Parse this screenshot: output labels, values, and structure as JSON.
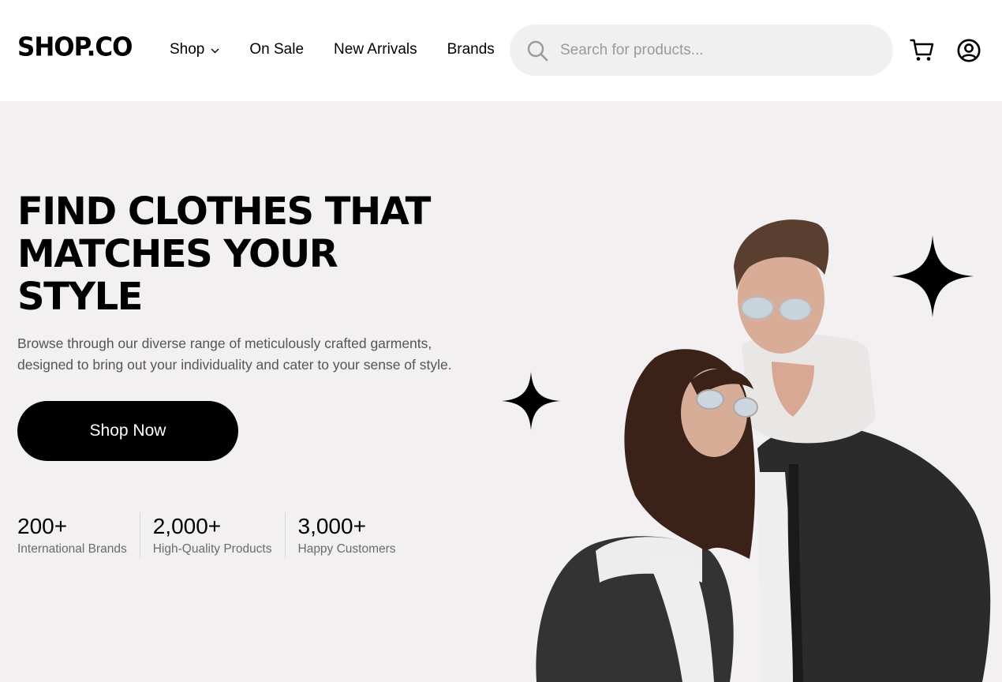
{
  "header": {
    "logo": "SHOP.CO",
    "nav": [
      {
        "label": "Shop",
        "has_dropdown": true
      },
      {
        "label": "On Sale"
      },
      {
        "label": "New Arrivals"
      },
      {
        "label": "Brands"
      }
    ],
    "search": {
      "placeholder": "Search for products...",
      "value": ""
    },
    "icons": [
      "search-icon",
      "cart-icon",
      "account-icon",
      "chevron-down-icon"
    ]
  },
  "hero": {
    "headline_lines": [
      "FIND CLOTHES THAT",
      "MATCHES YOUR",
      "STYLE"
    ],
    "description_lines": [
      "Browse through our diverse range of meticulously crafted garments,",
      "designed to bring out your individuality and cater to your sense of style."
    ],
    "cta_label": "Shop Now",
    "stats": [
      {
        "value": "200+",
        "label": "International Brands"
      },
      {
        "value": "2,000+",
        "label": "High-Quality Products"
      },
      {
        "value": "3,000+",
        "label": "Happy Customers"
      }
    ],
    "image": "models-photo",
    "decorations": [
      "sparkle-icon",
      "sparkle-icon"
    ]
  },
  "colors": {
    "primary": "#000000",
    "hero_background": "#f2f0f1",
    "search_background": "#f0f0f0",
    "muted_text": "#555555"
  }
}
